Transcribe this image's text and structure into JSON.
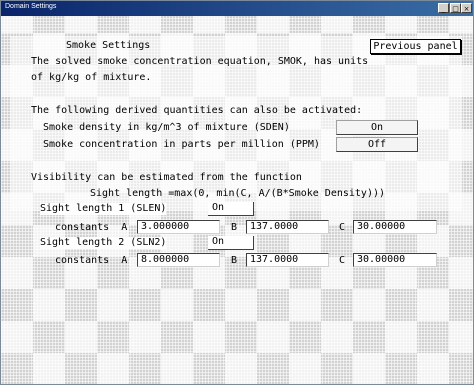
{
  "window": {
    "title": "Domain Settings"
  },
  "header": {
    "heading": "Smoke Settings",
    "prev_button": "Previous panel"
  },
  "intro": {
    "line1": "The solved smoke concentration equation, SMOK, has units",
    "line2": "of kg/kg of mixture."
  },
  "derived": {
    "heading": "The following derived quantities can also be activated:",
    "density_label": "Smoke density in kg/m^3 of mixture (SDEN)",
    "density_value": "On",
    "concentration_label": "Smoke concentration in parts per million (PPM)",
    "concentration_value": "Off"
  },
  "visibility": {
    "line1": "Visibility can be estimated from the function",
    "formula": "Sight length =max(0, min(C, A/(B*Smoke Density)))",
    "slen1_label": "Sight length 1 (SLEN)",
    "slen1_value": "On",
    "slen1_constants_label": "constants  A",
    "slen1_a": "3.000000",
    "slen1_b_label": "B",
    "slen1_b": "137.0000",
    "slen1_c_label": "C",
    "slen1_c": "30.00000",
    "slen2_label": "Sight length 2 (SLN2)",
    "slen2_value": "On",
    "slen2_constants_label": "constants  A",
    "slen2_a": "8.000000",
    "slen2_b_label": "B",
    "slen2_b": "137.0000",
    "slen2_c_label": "C",
    "slen2_c": "30.00000"
  }
}
